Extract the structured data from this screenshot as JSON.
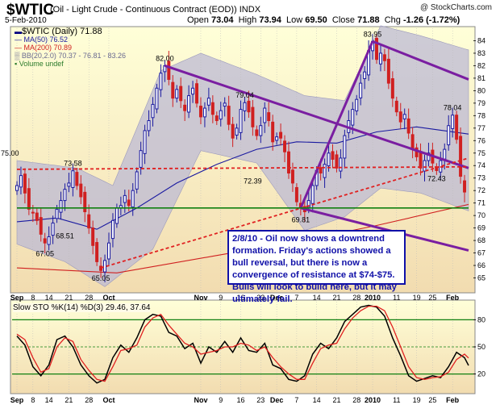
{
  "header": {
    "symbol": "$WTIC",
    "description": "(Oil - Light Crude - Continuous Contract (EOD))",
    "exchange": "INDX",
    "date": "5-Feb-2010",
    "credit": "@ StockCharts.com",
    "open_label": "Open",
    "open": "73.04",
    "high_label": "High",
    "high": "73.94",
    "low_label": "Low",
    "low": "69.50",
    "close_label": "Close",
    "close": "71.88",
    "chg_label": "Chg",
    "chg": "-1.26 (-1.72%)"
  },
  "legend": {
    "main": "$WTIC (Daily) 71.88",
    "ma50": "MA(50) 76.52",
    "ma200": "MA(200) 70.89",
    "bb": "BB(20,2.0) 70.37 - 76.81 - 83.26",
    "volume": "Volume undef",
    "sto": "Slow STO %K(14) %D(3) 29.46, 37.64"
  },
  "annotation": "2/8/10 - Oil now shows a downtrend formation. Friday's actions showed a bull reversal, but there is now a convergence of resistance at $74-$75. Bulls will look to build here, but it may ultimately fail.",
  "colors": {
    "up_candle": "#1a1aa0",
    "down_candle": "#d02020",
    "ma50": "#1a1aa0",
    "ma200": "#d02020",
    "bands": "#bcbad4",
    "trendline": "#7a1ea1",
    "support": "#108010",
    "resistance": "#e02020",
    "panel_bg_top": "#ffffd8",
    "panel_bg_bottom": "#f2dcb0"
  },
  "chart_data": {
    "type": "candlestick",
    "y_range": [
      64,
      85
    ],
    "y_ticks": [
      65,
      66,
      67,
      68,
      69,
      70,
      71,
      72,
      73,
      74,
      75,
      76,
      77,
      78,
      79,
      80,
      81,
      82,
      83,
      84
    ],
    "x_tick_labels": [
      "Sep",
      "8",
      "14",
      "21",
      "28",
      "Oct",
      "Nov",
      "9",
      "16",
      "23",
      "Dec",
      "7",
      "14",
      "21",
      "28",
      "2010",
      "11",
      "19",
      "25",
      "Feb"
    ],
    "x_tick_days": [
      0,
      4,
      8,
      13,
      18,
      23,
      46,
      51,
      56,
      61,
      65,
      70,
      75,
      80,
      85,
      89,
      95,
      100,
      104,
      109
    ],
    "total_days": 113,
    "closes": [
      72.4,
      73.2,
      71.8,
      70.5,
      70.2,
      69.6,
      68.5,
      67.8,
      68.3,
      69.4,
      70.5,
      71.2,
      72.1,
      72.6,
      73.58,
      72.4,
      71.5,
      70.3,
      69.0,
      67.6,
      66.3,
      65.6,
      66.4,
      67.8,
      69.6,
      70.6,
      70.8,
      71.6,
      70.8,
      72.0,
      73.5,
      75.2,
      76.8,
      77.6,
      78.9,
      80.2,
      81.4,
      82.0,
      80.9,
      79.4,
      80.1,
      79.2,
      78.4,
      79.6,
      80.2,
      79.0,
      77.9,
      78.6,
      79.4,
      78.1,
      77.6,
      78.4,
      79.0,
      77.3,
      76.2,
      77.0,
      78.5,
      79.04,
      78.3,
      77.1,
      76.4,
      77.2,
      78.6,
      77.6,
      75.9,
      76.3,
      76.2,
      75.1,
      73.4,
      72.6,
      71.1,
      70.6,
      70.3,
      71.2,
      72.4,
      73.6,
      73.4,
      74.1,
      75.0,
      74.5,
      73.8,
      74.6,
      76.4,
      77.6,
      78.5,
      79.3,
      80.6,
      81.5,
      83.2,
      83.95,
      82.5,
      83.0,
      82.4,
      80.6,
      79.4,
      78.3,
      77.5,
      78.1,
      76.6,
      75.3,
      74.7,
      73.8,
      74.4,
      75.0,
      74.2,
      73.6,
      74.4,
      75.3,
      77.2,
      78.04,
      76.1,
      73.14,
      71.88
    ],
    "ma50": [
      [
        0,
        69.5
      ],
      [
        10,
        69.8
      ],
      [
        20,
        68.9
      ],
      [
        30,
        70.6
      ],
      [
        40,
        72.6
      ],
      [
        50,
        74.1
      ],
      [
        60,
        75.3
      ],
      [
        70,
        75.9
      ],
      [
        80,
        75.8
      ],
      [
        90,
        76.7
      ],
      [
        100,
        77.1
      ],
      [
        113,
        76.52
      ]
    ],
    "ma200": [
      [
        0,
        65.8
      ],
      [
        25,
        65.4
      ],
      [
        50,
        66.8
      ],
      [
        70,
        67.9
      ],
      [
        90,
        69.2
      ],
      [
        113,
        70.89
      ]
    ],
    "bb_upper": [
      [
        0,
        74.4
      ],
      [
        15,
        73.8
      ],
      [
        24,
        72.4
      ],
      [
        36,
        81.6
      ],
      [
        46,
        83.0
      ],
      [
        60,
        81.3
      ],
      [
        72,
        79.6
      ],
      [
        82,
        79.2
      ],
      [
        91,
        85.2
      ],
      [
        101,
        84.4
      ],
      [
        113,
        83.26
      ]
    ],
    "bb_lower": [
      [
        0,
        67.7
      ],
      [
        12,
        66.3
      ],
      [
        22,
        64.3
      ],
      [
        34,
        67.3
      ],
      [
        46,
        75.2
      ],
      [
        60,
        74.2
      ],
      [
        72,
        68.8
      ],
      [
        82,
        69.9
      ],
      [
        91,
        72.2
      ],
      [
        101,
        71.8
      ],
      [
        113,
        70.37
      ]
    ],
    "trendlines": [
      {
        "points": [
          [
            37,
            82.0
          ],
          [
            113,
            73.8
          ]
        ],
        "style": "purple-solid"
      },
      {
        "points": [
          [
            71,
            70.6
          ],
          [
            89,
            83.95
          ]
        ],
        "style": "purple-solid"
      },
      {
        "points": [
          [
            89,
            83.95
          ],
          [
            113,
            80.9
          ]
        ],
        "style": "purple-solid"
      },
      {
        "points": [
          [
            71,
            70.6
          ],
          [
            113,
            67.2
          ]
        ],
        "style": "purple-solid"
      },
      {
        "points": [
          [
            0,
            73.7
          ],
          [
            113,
            73.9
          ]
        ],
        "style": "red-dashed"
      },
      {
        "points": [
          [
            21,
            65.8
          ],
          [
            113,
            74.6
          ]
        ],
        "style": "red-dashed"
      },
      {
        "points": [
          [
            0,
            70.6
          ],
          [
            113,
            70.6
          ]
        ],
        "style": "green-solid"
      }
    ],
    "price_labels": [
      {
        "day": 14,
        "value": 73.58,
        "text": "73.58",
        "pos": "above"
      },
      {
        "day": 7,
        "value": 67.6,
        "text": "67.05",
        "pos": "below"
      },
      {
        "day": 12,
        "value": 69.0,
        "text": "68.51",
        "pos": "below"
      },
      {
        "day": 21,
        "value": 65.6,
        "text": "65.05",
        "pos": "below"
      },
      {
        "day": 37,
        "value": 82.0,
        "text": "82.00",
        "pos": "above"
      },
      {
        "day": 57,
        "value": 79.04,
        "text": "79.04",
        "pos": "above"
      },
      {
        "day": 59,
        "value": 73.4,
        "text": "72.39",
        "pos": "below"
      },
      {
        "day": 71,
        "value": 70.3,
        "text": "69.81",
        "pos": "below"
      },
      {
        "day": 89,
        "value": 83.95,
        "text": "83.95",
        "pos": "above"
      },
      {
        "day": 105,
        "value": 73.6,
        "text": "72.43",
        "pos": "below"
      },
      {
        "day": 109,
        "value": 78.04,
        "text": "78.04",
        "pos": "above"
      },
      {
        "day": 0,
        "value": 75.0,
        "text": "75.00",
        "pos": "left"
      }
    ],
    "sto_y_range": [
      0,
      100
    ],
    "sto_levels": [
      80,
      50,
      20
    ],
    "sto_k": [
      [
        0,
        62
      ],
      [
        2,
        52
      ],
      [
        4,
        28
      ],
      [
        6,
        18
      ],
      [
        8,
        30
      ],
      [
        10,
        58
      ],
      [
        12,
        62
      ],
      [
        14,
        50
      ],
      [
        16,
        30
      ],
      [
        18,
        18
      ],
      [
        20,
        10
      ],
      [
        22,
        14
      ],
      [
        24,
        38
      ],
      [
        26,
        52
      ],
      [
        28,
        44
      ],
      [
        30,
        60
      ],
      [
        32,
        80
      ],
      [
        34,
        86
      ],
      [
        36,
        84
      ],
      [
        38,
        66
      ],
      [
        40,
        62
      ],
      [
        42,
        48
      ],
      [
        44,
        54
      ],
      [
        46,
        32
      ],
      [
        48,
        50
      ],
      [
        50,
        44
      ],
      [
        52,
        56
      ],
      [
        54,
        44
      ],
      [
        56,
        60
      ],
      [
        58,
        46
      ],
      [
        60,
        44
      ],
      [
        62,
        54
      ],
      [
        64,
        30
      ],
      [
        66,
        26
      ],
      [
        68,
        14
      ],
      [
        70,
        12
      ],
      [
        72,
        18
      ],
      [
        74,
        42
      ],
      [
        76,
        54
      ],
      [
        78,
        48
      ],
      [
        80,
        60
      ],
      [
        82,
        78
      ],
      [
        84,
        86
      ],
      [
        86,
        94
      ],
      [
        88,
        96
      ],
      [
        90,
        94
      ],
      [
        92,
        84
      ],
      [
        94,
        60
      ],
      [
        96,
        40
      ],
      [
        98,
        18
      ],
      [
        100,
        12
      ],
      [
        102,
        15
      ],
      [
        104,
        18
      ],
      [
        106,
        16
      ],
      [
        108,
        28
      ],
      [
        110,
        44
      ],
      [
        112,
        38
      ],
      [
        113,
        29.46
      ]
    ],
    "sto_d": [
      [
        0,
        64
      ],
      [
        2,
        58
      ],
      [
        4,
        38
      ],
      [
        6,
        22
      ],
      [
        8,
        26
      ],
      [
        10,
        50
      ],
      [
        12,
        60
      ],
      [
        14,
        56
      ],
      [
        16,
        36
      ],
      [
        18,
        24
      ],
      [
        20,
        14
      ],
      [
        22,
        12
      ],
      [
        24,
        28
      ],
      [
        26,
        46
      ],
      [
        28,
        48
      ],
      [
        30,
        52
      ],
      [
        32,
        72
      ],
      [
        34,
        82
      ],
      [
        36,
        86
      ],
      [
        38,
        74
      ],
      [
        40,
        64
      ],
      [
        42,
        54
      ],
      [
        44,
        50
      ],
      [
        46,
        42
      ],
      [
        48,
        44
      ],
      [
        50,
        46
      ],
      [
        52,
        50
      ],
      [
        54,
        50
      ],
      [
        56,
        54
      ],
      [
        58,
        52
      ],
      [
        60,
        46
      ],
      [
        62,
        50
      ],
      [
        64,
        38
      ],
      [
        66,
        28
      ],
      [
        68,
        20
      ],
      [
        70,
        14
      ],
      [
        72,
        14
      ],
      [
        74,
        32
      ],
      [
        76,
        48
      ],
      [
        78,
        52
      ],
      [
        80,
        54
      ],
      [
        82,
        70
      ],
      [
        84,
        82
      ],
      [
        86,
        90
      ],
      [
        88,
        95
      ],
      [
        90,
        95
      ],
      [
        92,
        90
      ],
      [
        94,
        72
      ],
      [
        96,
        50
      ],
      [
        98,
        28
      ],
      [
        100,
        16
      ],
      [
        102,
        14
      ],
      [
        104,
        16
      ],
      [
        106,
        17
      ],
      [
        108,
        22
      ],
      [
        110,
        36
      ],
      [
        112,
        42
      ],
      [
        113,
        37.64
      ]
    ]
  }
}
